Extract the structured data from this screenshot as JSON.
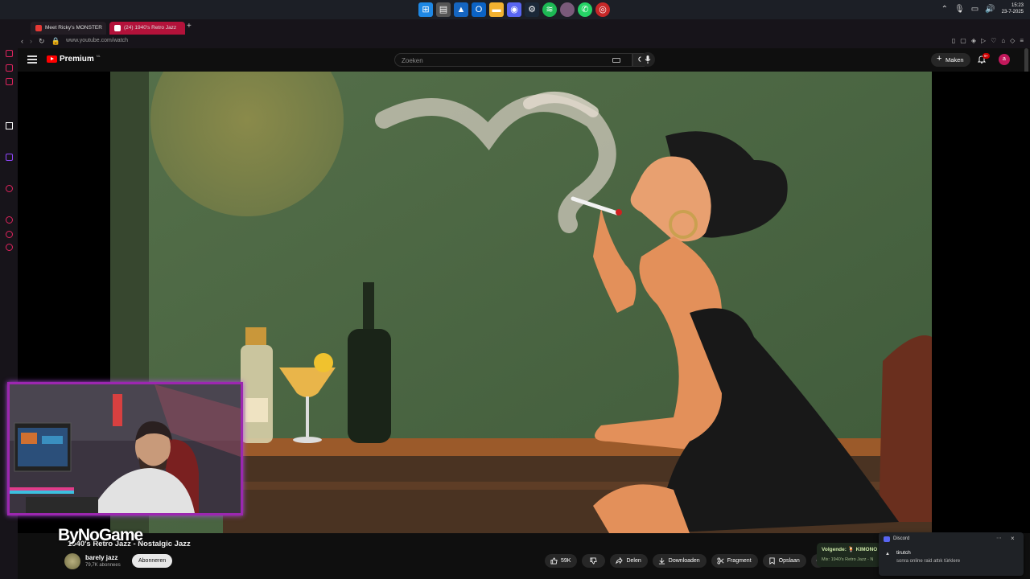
{
  "taskbar": {
    "apps": [
      "windows-start",
      "file-manager",
      "photos",
      "outlook",
      "explorer",
      "discord",
      "steam",
      "spotify",
      "obs",
      "whatsapp",
      "chrome"
    ],
    "time": "15:23",
    "date": "23-7-2025"
  },
  "browser": {
    "tabs": [
      {
        "label": "Meet Ricky's MONSTER",
        "active": false
      },
      {
        "label": "(24) 1940's Retro Jazz",
        "active": true
      }
    ],
    "url": "www.youtube.com/watch",
    "accent": "#c2185b"
  },
  "youtube": {
    "logo_text": "Premium",
    "logo_region": "NL",
    "search_placeholder": "Zoeken",
    "create_label": "Maken",
    "notifications": "9+",
    "avatar_letter": "a"
  },
  "webcam": {
    "overlay_text": "ByNoGame"
  },
  "video": {
    "title": "1940's Retro Jazz - Nostalgic Jazz",
    "channel": "barely jazz",
    "subscribers": "79,7K abonnees",
    "subscribe_label": "Abonneren",
    "likes": "59K",
    "share_label": "Delen",
    "download_label": "Downloaden",
    "clip_label": "Fragment",
    "save_label": "Opslaan",
    "next_label": "Volgende: 🍹 KIMONO",
    "next_sub": "Mix: 1940's Retro Jazz - N"
  },
  "toast": {
    "app": "Discord",
    "user": "tirutch",
    "message": "sonra online raid attık türklere"
  }
}
